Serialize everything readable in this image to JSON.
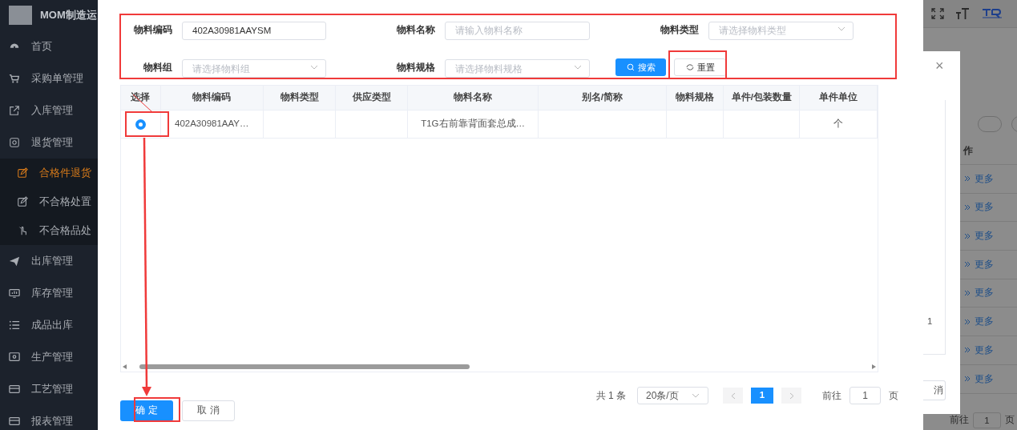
{
  "sidebar": {
    "title": "MOM制造运",
    "items": [
      {
        "label": "首页",
        "selected": false
      },
      {
        "label": "采购单管理",
        "selected": false
      },
      {
        "label": "入库管理",
        "selected": false
      },
      {
        "label": "退货管理",
        "selected": false,
        "expanded": true,
        "children": [
          {
            "label": "合格件退货",
            "selected": true
          },
          {
            "label": "不合格处置",
            "selected": false
          },
          {
            "label": "不合格品处",
            "selected": false
          }
        ]
      },
      {
        "label": "出库管理",
        "selected": false
      },
      {
        "label": "库存管理",
        "selected": false
      },
      {
        "label": "成品出库",
        "selected": false
      },
      {
        "label": "生产管理",
        "selected": false
      },
      {
        "label": "工艺管理",
        "selected": false
      },
      {
        "label": "报表管理",
        "selected": false
      }
    ]
  },
  "dialog": {
    "filters": [
      {
        "label": "物料编码",
        "kind": "input",
        "value": "402A30981AAYSM"
      },
      {
        "label": "物料名称",
        "kind": "input",
        "placeholder": "请输入物料名称"
      },
      {
        "label": "物料类型",
        "kind": "select",
        "placeholder": "请选择物料类型"
      },
      {
        "label": "物料组",
        "kind": "select",
        "placeholder": "请选择物料组"
      },
      {
        "label": "物料规格",
        "kind": "select",
        "placeholder": "请选择物料规格"
      }
    ],
    "search_button": "搜索",
    "reset_button": "重置",
    "table": {
      "columns": [
        {
          "label": "选择",
          "kind": "radio"
        },
        {
          "label": "物料编码",
          "kind": "code"
        },
        {
          "label": "物料类型",
          "kind": "type"
        },
        {
          "label": "供应类型",
          "kind": "supply"
        },
        {
          "label": "物料名称",
          "kind": "name"
        },
        {
          "label": "别名/简称",
          "kind": "alias"
        },
        {
          "label": "物料规格",
          "kind": "spec"
        },
        {
          "label": "单件/包装数量",
          "kind": "qty"
        },
        {
          "label": "单件单位",
          "kind": "unit"
        }
      ],
      "rows": [
        {
          "selected": true,
          "code": "402A30981AAY…",
          "name": "T1G右前靠背面套总成…",
          "unit": "个"
        }
      ]
    },
    "pagination": {
      "total": "共 1 条",
      "page_size": "20条/页",
      "pages": [
        {
          "label": "1",
          "selected": true
        }
      ],
      "goto_label": "前往",
      "goto_value": "1",
      "goto_suffix": "页"
    },
    "confirm_button": "确 定",
    "cancel_button": "取 消"
  },
  "background": {
    "behind_dialog": {
      "close": "×",
      "cell": "1",
      "button": "消"
    },
    "action_header": "作",
    "row_actions": [
      "更多",
      "更多",
      "更多",
      "更多",
      "更多",
      "更多",
      "更多",
      "更多"
    ],
    "goto_label": "前往",
    "goto_value": "1",
    "goto_suffix": "页"
  }
}
